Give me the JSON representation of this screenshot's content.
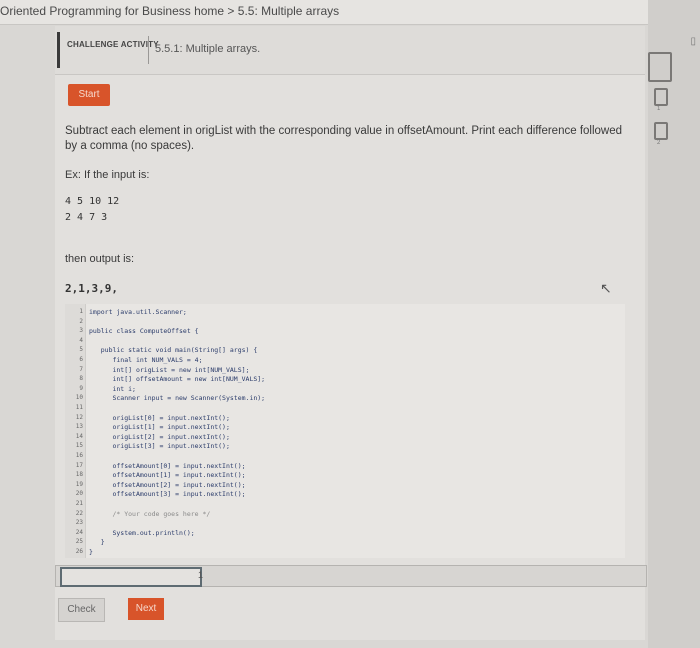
{
  "breadcrumb": "Oriented Programming for Business home > 5.5: Multiple arrays",
  "header": {
    "badge": "CHALLENGE ACTIVITY",
    "title": "5.5.1: Multiple arrays."
  },
  "start_label": "Start",
  "prompt": "Subtract each element in origList with the corresponding value in offsetAmount. Print each difference followed by a comma (no spaces).",
  "example_label": "Ex: If the input is:",
  "input_line1": "4 5 10 12",
  "input_line2": "2 4 7 3",
  "then_label": "then output is:",
  "output_value": "2,1,3,9,",
  "code_lines": [
    "import java.util.Scanner;",
    "",
    "public class ComputeOffset {",
    "",
    "   public static void main(String[] args) {",
    "      final int NUM_VALS = 4;",
    "      int[] origList = new int[NUM_VALS];",
    "      int[] offsetAmount = new int[NUM_VALS];",
    "      int i;",
    "      Scanner input = new Scanner(System.in);",
    "",
    "      origList[0] = input.nextInt();",
    "      origList[1] = input.nextInt();",
    "      origList[2] = input.nextInt();",
    "      origList[3] = input.nextInt();",
    "",
    "      offsetAmount[0] = input.nextInt();",
    "      offsetAmount[1] = input.nextInt();",
    "      offsetAmount[2] = input.nextInt();",
    "      offsetAmount[3] = input.nextInt();",
    "",
    "      /* Your code goes here */",
    "",
    "      System.out.println();",
    "   }",
    "}"
  ],
  "line_numbers": [
    "1",
    "2",
    "3",
    "4",
    "5",
    "6",
    "7",
    "8",
    "9",
    "10",
    "11",
    "12",
    "13",
    "14",
    "15",
    "16",
    "17",
    "18",
    "19",
    "20",
    "21",
    "22",
    "23",
    "24",
    "25",
    "26"
  ],
  "result_number": "1",
  "check_label": "Check",
  "next_label": "Next",
  "levels": [
    "1",
    "2"
  ]
}
